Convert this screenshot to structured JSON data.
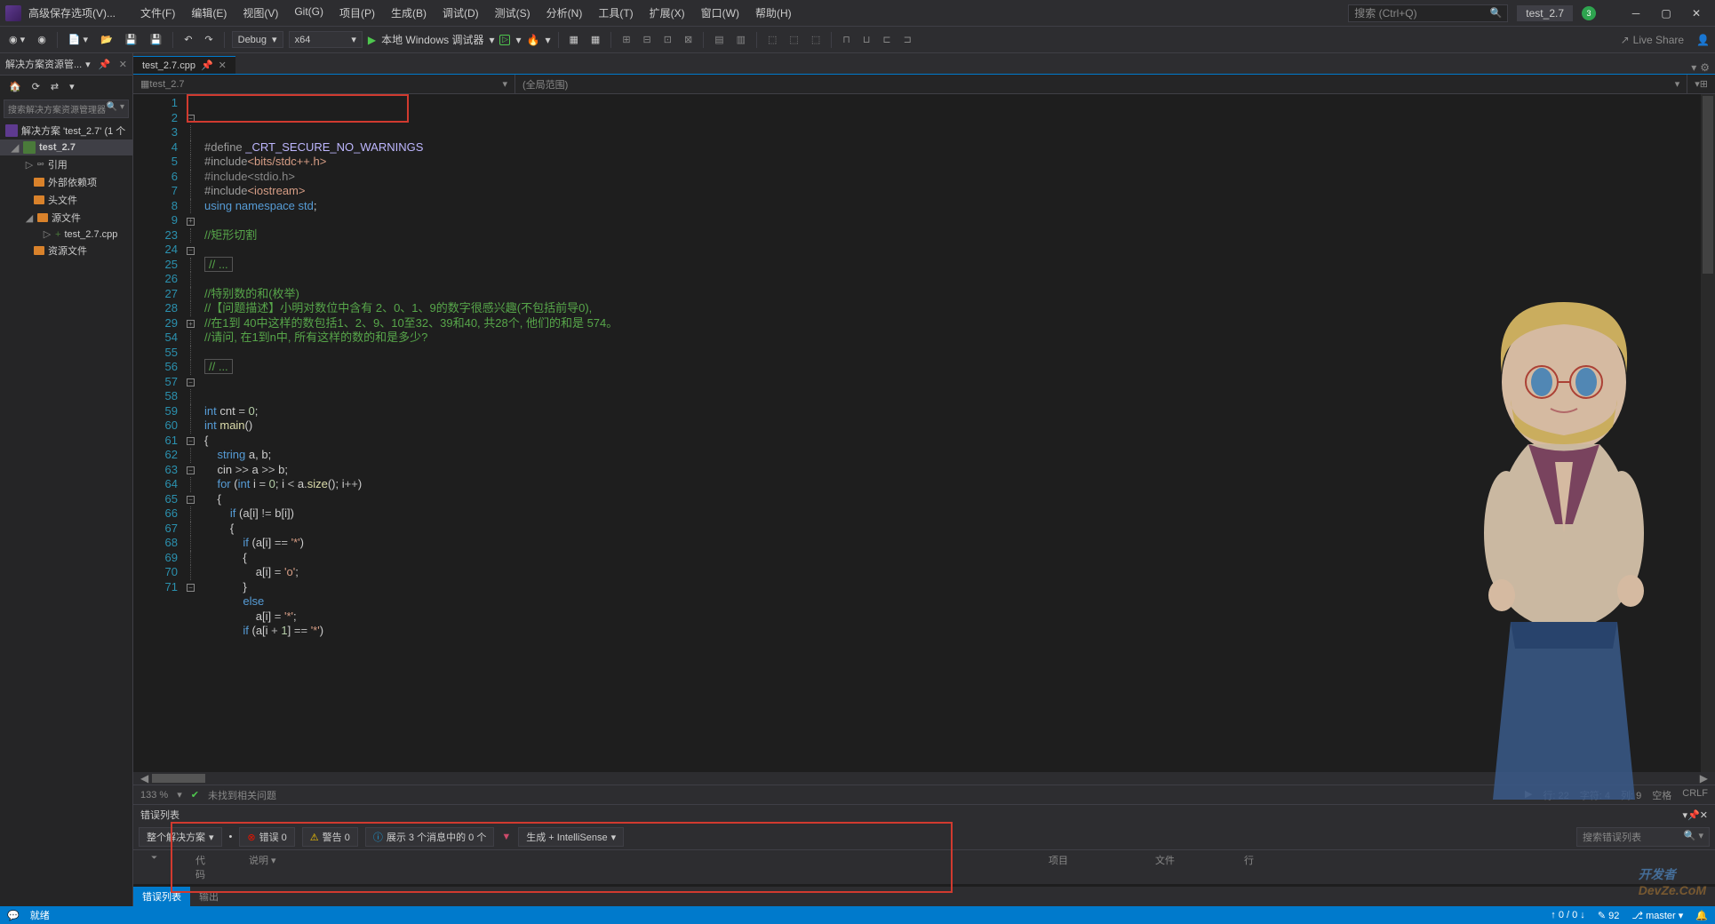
{
  "titlebar": {
    "title": "高级保存选项(V)...",
    "search_placeholder": "搜索 (Ctrl+Q)",
    "project_button": "test_2.7",
    "notif_count": "3"
  },
  "menubar": [
    "文件(F)",
    "编辑(E)",
    "视图(V)",
    "Git(G)",
    "项目(P)",
    "生成(B)",
    "调试(D)",
    "测试(S)",
    "分析(N)",
    "工具(T)",
    "扩展(X)",
    "窗口(W)",
    "帮助(H)"
  ],
  "toolbar": {
    "config": "Debug",
    "platform": "x64",
    "debugger": "本地 Windows 调试器",
    "liveshare": "Live Share"
  },
  "solexp": {
    "title": "解决方案资源管...",
    "search_placeholder": "搜索解决方案资源管理器",
    "solution": "解决方案 'test_2.7' (1 个",
    "project": "test_2.7",
    "refs": "引用",
    "ext_deps": "外部依赖项",
    "headers": "头文件",
    "sources": "源文件",
    "cpp_file": "test_2.7.cpp",
    "resources": "资源文件"
  },
  "tabs": {
    "active": "test_2.7.cpp"
  },
  "navbar": {
    "left": "test_2.7",
    "mid": "(全局范围)",
    "right": ""
  },
  "code": {
    "lines": [
      {
        "n": "1",
        "fold": "",
        "html": "<span class='c-include'>#define</span> <span class='c-macro'>_CRT_SECURE_NO_WARNINGS</span>"
      },
      {
        "n": "2",
        "fold": "⊟",
        "html": "<span class='c-include'>#include</span><span class='c-string'>&lt;bits/stdc++.h&gt;</span>"
      },
      {
        "n": "3",
        "fold": "│",
        "html": "<span class='c-include c-gray'>#include&lt;stdio.h&gt;</span>"
      },
      {
        "n": "4",
        "fold": "│",
        "html": "<span class='c-include'>#include</span><span class='c-string'>&lt;iostream&gt;</span>"
      },
      {
        "n": "5",
        "fold": "│",
        "html": "<span class='c-keyword'>using</span> <span class='c-keyword'>namespace</span> <span class='c-type'>std</span><span class='c-punc'>;</span>"
      },
      {
        "n": "6",
        "fold": "│",
        "html": ""
      },
      {
        "n": "7",
        "fold": "│",
        "html": "<span class='c-comment'>//矩形切割</span>"
      },
      {
        "n": "8",
        "fold": "│",
        "html": ""
      },
      {
        "n": "9",
        "fold": "⊞",
        "html": "<span class='c-comment' style='border:1px solid #555;padding:0 4px'>// ...</span>"
      },
      {
        "n": "23",
        "fold": "│",
        "html": ""
      },
      {
        "n": "24",
        "fold": "⊟",
        "html": "<span class='c-comment'>//特别数的和(枚举)</span>"
      },
      {
        "n": "25",
        "fold": "│",
        "html": "<span class='c-comment'>//【问题描述】小明对数位中含有 2、0、1、9的数字很感兴趣(不包括前导0),</span>"
      },
      {
        "n": "26",
        "fold": "│",
        "html": "<span class='c-comment'>//在1到 40中这样的数包括1、2、9、10至32、39和40, 共28个, 他们的和是 574。</span>"
      },
      {
        "n": "27",
        "fold": "│",
        "html": "<span class='c-comment'>//请问, 在1到n中, 所有这样的数的和是多少?</span>"
      },
      {
        "n": "28",
        "fold": "│",
        "html": ""
      },
      {
        "n": "29",
        "fold": "⊞",
        "html": "<span class='c-comment' style='border:1px solid #555;padding:0 4px'>// ...</span>"
      },
      {
        "n": "54",
        "fold": "│",
        "html": ""
      },
      {
        "n": "55",
        "fold": "│",
        "html": ""
      },
      {
        "n": "56",
        "fold": "│",
        "html": "<span class='c-keyword'>int</span> cnt <span class='c-op'>=</span> <span class='c-num'>0</span><span class='c-punc'>;</span>"
      },
      {
        "n": "57",
        "fold": "⊟",
        "html": "<span class='c-keyword'>int</span> <span class='c-fn'>main</span><span class='c-punc'>()</span>"
      },
      {
        "n": "58",
        "fold": "│",
        "html": "<span class='c-punc'>{</span>"
      },
      {
        "n": "59",
        "fold": "│",
        "html": "    <span class='c-type'>string</span> a<span class='c-punc'>,</span> b<span class='c-punc'>;</span>"
      },
      {
        "n": "60",
        "fold": "│",
        "html": "    cin <span class='c-op'>&gt;&gt;</span> a <span class='c-op'>&gt;&gt;</span> b<span class='c-punc'>;</span>"
      },
      {
        "n": "61",
        "fold": "⊟",
        "html": "    <span class='c-keyword'>for</span> <span class='c-punc'>(</span><span class='c-keyword'>int</span> i <span class='c-op'>=</span> <span class='c-num'>0</span><span class='c-punc'>;</span> i <span class='c-op'>&lt;</span> a<span class='c-punc'>.</span><span class='c-fn'>size</span><span class='c-punc'>();</span> i<span class='c-op'>++</span><span class='c-punc'>)</span>"
      },
      {
        "n": "62",
        "fold": "│",
        "html": "    <span class='c-punc'>{</span>"
      },
      {
        "n": "63",
        "fold": "⊟",
        "html": "        <span class='c-keyword'>if</span> <span class='c-punc'>(</span>a<span class='c-punc'>[</span>i<span class='c-punc'>]</span> <span class='c-op'>!=</span> b<span class='c-punc'>[</span>i<span class='c-punc'>])</span>"
      },
      {
        "n": "64",
        "fold": "│",
        "html": "        <span class='c-punc'>{</span>"
      },
      {
        "n": "65",
        "fold": "⊟",
        "html": "            <span class='c-keyword'>if</span> <span class='c-punc'>(</span>a<span class='c-punc'>[</span>i<span class='c-punc'>]</span> <span class='c-op'>==</span> <span class='c-string'>'*'</span><span class='c-punc'>)</span>"
      },
      {
        "n": "66",
        "fold": "│",
        "html": "            <span class='c-punc'>{</span>"
      },
      {
        "n": "67",
        "fold": "│",
        "html": "                a<span class='c-punc'>[</span>i<span class='c-punc'>]</span> <span class='c-op'>=</span> <span class='c-string'>'o'</span><span class='c-punc'>;</span>"
      },
      {
        "n": "68",
        "fold": "│",
        "html": "            <span class='c-punc'>}</span>"
      },
      {
        "n": "69",
        "fold": "│",
        "html": "            <span class='c-keyword'>else</span>"
      },
      {
        "n": "70",
        "fold": "│",
        "html": "                a<span class='c-punc'>[</span>i<span class='c-punc'>]</span> <span class='c-op'>=</span> <span class='c-string'>'*'</span><span class='c-punc'>;</span>"
      },
      {
        "n": "71",
        "fold": "⊟",
        "html": "            <span class='c-keyword'>if</span> <span class='c-punc'>(</span>a<span class='c-punc'>[</span>i <span class='c-op'>+</span> <span class='c-num'>1</span><span class='c-punc'>]</span> <span class='c-op'>==</span> <span class='c-string'>'*'</span><span class='c-punc'>)</span>"
      }
    ]
  },
  "editor_status": {
    "zoom": "133 %",
    "no_issues": "未找到相关问题",
    "line": "行: 22",
    "char": "字符: 4",
    "col": "列: 9",
    "space": "空格",
    "eol": "CRLF"
  },
  "errorlist": {
    "title": "错误列表",
    "scope": "整个解决方案",
    "errors": "错误 0",
    "warnings": "警告 0",
    "messages": "展示 3 个消息中的 0 个",
    "intellisense": "生成 + IntelliSense",
    "search_placeholder": "搜索错误列表",
    "cols": {
      "code": "代码",
      "desc": "说明",
      "project": "项目",
      "file": "文件",
      "line": "行"
    }
  },
  "bottom_tabs": [
    "错误列表",
    "输出"
  ],
  "statusbar": {
    "ready": "就绪",
    "updown": "↑ 0 / 0 ↓",
    "commits": "92",
    "branch": "master",
    "git_icon": "⎇"
  },
  "watermark": {
    "line1": "开发者",
    "line2": "DevZe.CoM"
  }
}
